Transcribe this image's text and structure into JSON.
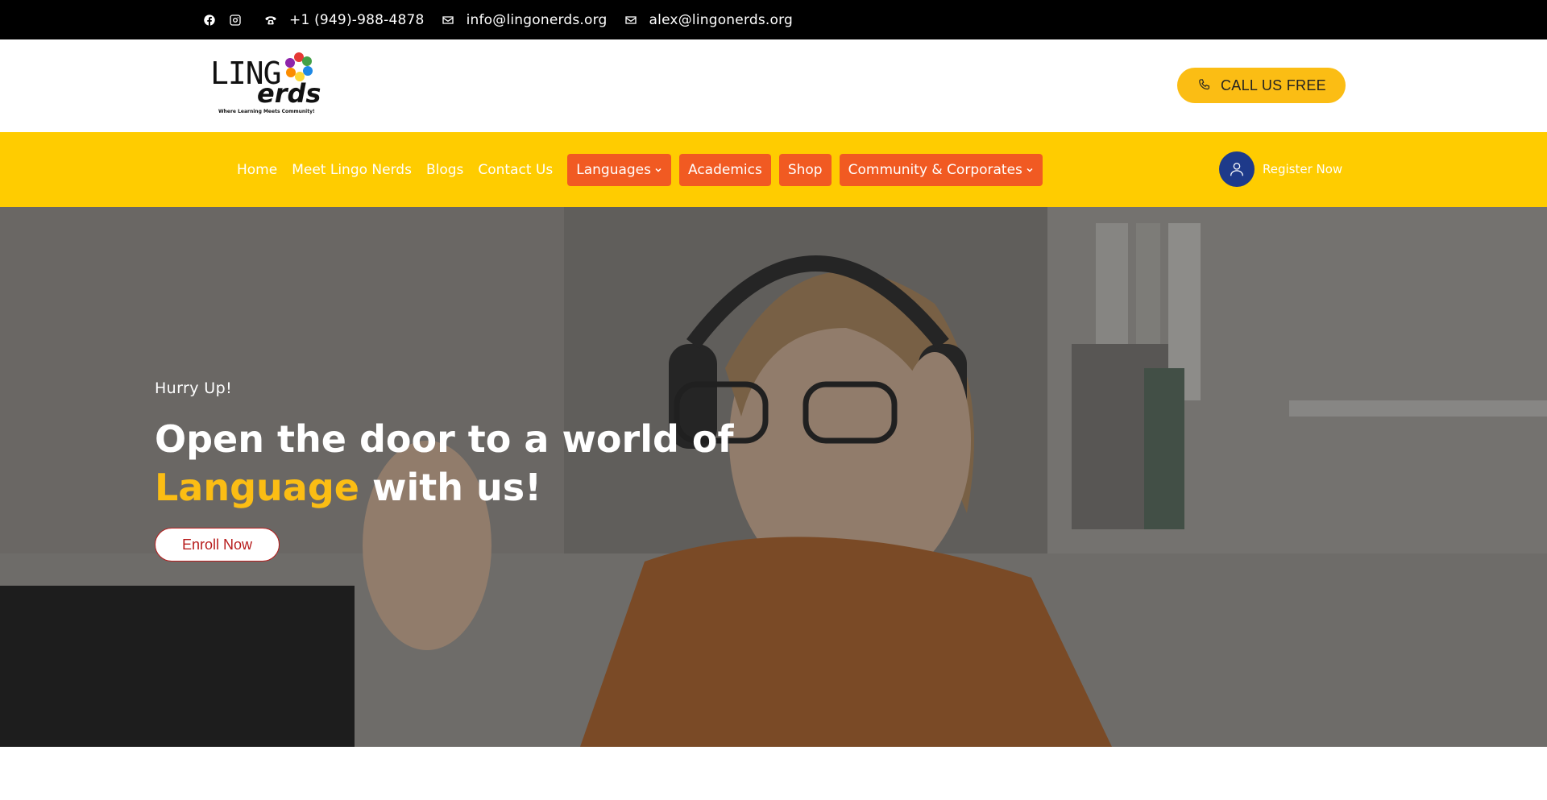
{
  "topbar": {
    "phone": "+1 (949)-988-4878",
    "email_1": "info@lingonerds.org",
    "email_2": "alex@lingonerds.org",
    "icons": [
      "facebook-icon",
      "instagram-icon",
      "phone-icon",
      "mail-icon",
      "mail-icon"
    ]
  },
  "header": {
    "logo": {
      "wordmark_top": "LING",
      "wordmark_bottom": "erds",
      "tagline": "Where Learning Meets Community!"
    },
    "call_button": "CALL US FREE"
  },
  "nav": {
    "links": [
      "Home",
      "Meet Lingo Nerds",
      "Blogs",
      "Contact Us"
    ],
    "buttons": [
      {
        "label": "Languages",
        "dropdown": true
      },
      {
        "label": "Academics",
        "dropdown": false
      },
      {
        "label": "Shop",
        "dropdown": false
      },
      {
        "label": "Community & Corporates",
        "dropdown": true
      }
    ],
    "register": "Register Now"
  },
  "hero": {
    "eyebrow": "Hurry Up!",
    "headline_line1": "Open the door to a world of",
    "headline_accent": "Language",
    "headline_rest": " with us!",
    "cta": "Enroll Now"
  },
  "colors": {
    "topbar_bg": "#000000",
    "nav_bg": "#ffcc00",
    "nav_button_bg": "#f15a22",
    "call_button_bg": "#fbbd14",
    "accent_text": "#fbbd14",
    "register_avatar_bg": "#1e3a8a",
    "cta_border": "#b71c1c"
  }
}
